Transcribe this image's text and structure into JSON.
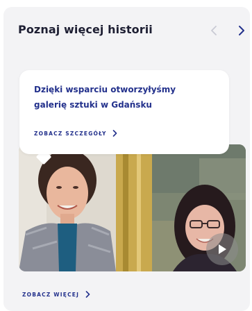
{
  "header": {
    "title": "Poznaj więcej historii"
  },
  "story": {
    "title": "Dzięki wsparciu otworzyłyśmy galerię sztuki w Gdańsku",
    "details_label": "ZOBACZ SZCZEGÓŁY"
  },
  "footer": {
    "more_label": "ZOBACZ WIĘCEJ"
  },
  "colors": {
    "accent": "#23318c",
    "card_background": "#f3f3f5",
    "title_text": "#1e1f33"
  },
  "icons": {
    "prev": "chevron-left-icon",
    "next": "chevron-right-icon",
    "play": "play-icon"
  }
}
